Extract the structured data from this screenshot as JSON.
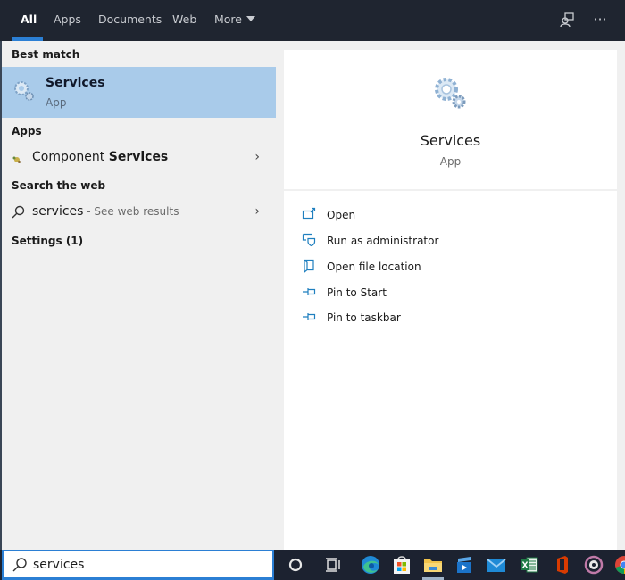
{
  "tabs": [
    {
      "label": "All",
      "active": true
    },
    {
      "label": "Apps"
    },
    {
      "label": "Documents"
    },
    {
      "label": "Web"
    },
    {
      "label": "More"
    }
  ],
  "top_icons": [
    "feedback-icon",
    "more-options-icon"
  ],
  "more_options_glyph": "···",
  "results": {
    "best_match_title": "Best match",
    "best_match": {
      "name": "Services",
      "type": "App",
      "icon": "gear-services-icon"
    },
    "apps_title": "Apps",
    "apps": [
      {
        "prefix": "Component ",
        "highlight": "Services",
        "icon": "component-services-icon"
      }
    ],
    "web_title": "Search the web",
    "web": [
      {
        "query": "services",
        "suffix": " - See web results",
        "icon": "search-icon"
      }
    ],
    "settings_title": "Settings (1)",
    "chevron_glyph": "›"
  },
  "detail": {
    "name": "Services",
    "type": "App",
    "actions": [
      {
        "label": "Open",
        "icon": "open-icon"
      },
      {
        "label": "Run as administrator",
        "icon": "run-as-admin-icon"
      },
      {
        "label": "Open file location",
        "icon": "file-location-icon"
      },
      {
        "label": "Pin to Start",
        "icon": "pin-icon"
      },
      {
        "label": "Pin to taskbar",
        "icon": "pin-icon"
      }
    ]
  },
  "search": {
    "value": "services"
  },
  "taskbar": {
    "apps": [
      "cortana",
      "task-view",
      "edge",
      "microsoft-store",
      "file-explorer",
      "media-player",
      "mail",
      "excel",
      "office",
      "groove-music",
      "chrome"
    ]
  },
  "colors": {
    "accent": "#2b7fd4",
    "selection": "#a9cbea",
    "topbar": "#1f2530",
    "taskbar": "#1c2230",
    "action_icon": "#1f7fbf"
  }
}
